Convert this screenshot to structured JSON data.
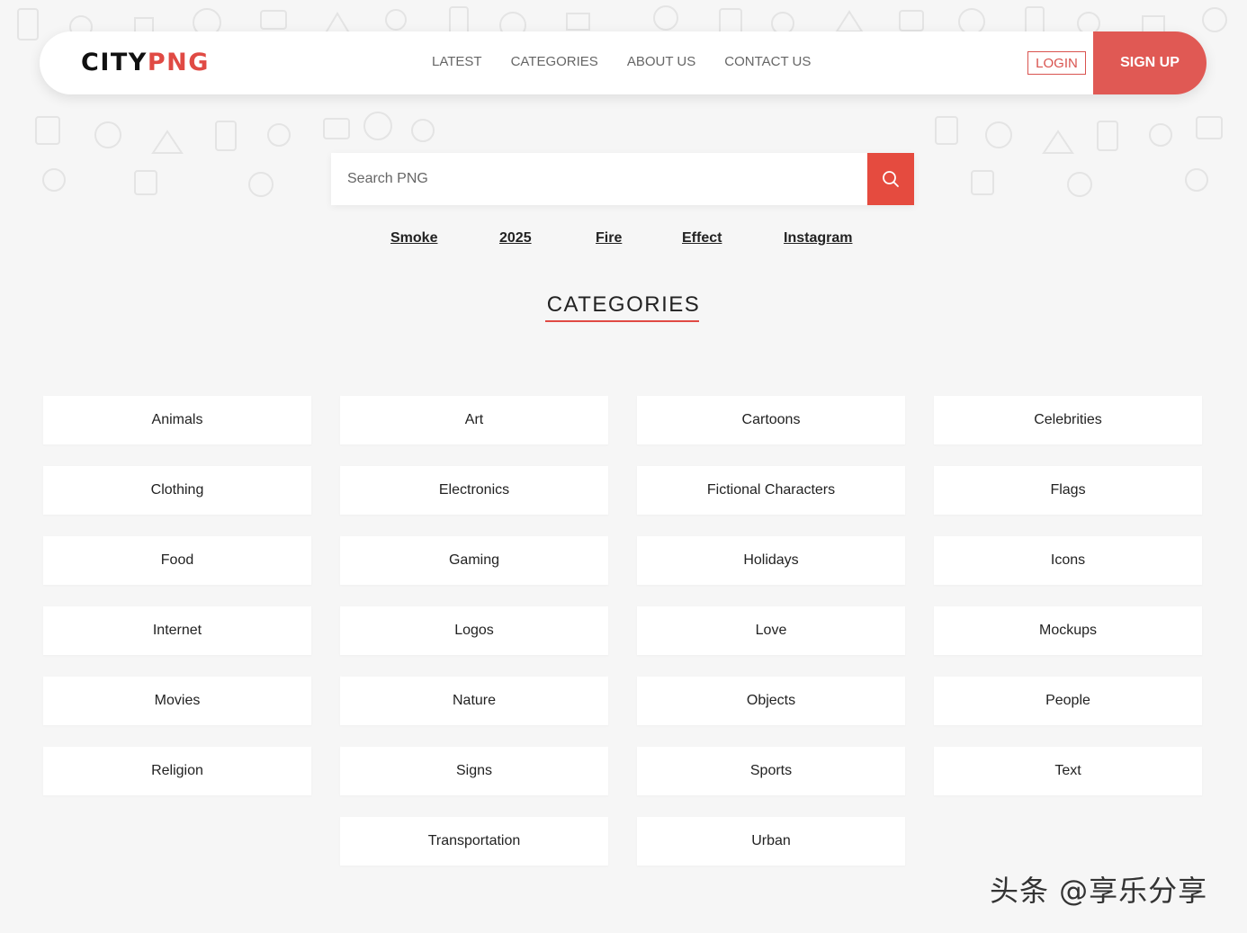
{
  "header": {
    "logo_city": "CITY",
    "logo_png": "PNG",
    "nav": [
      "LATEST",
      "CATEGORIES",
      "ABOUT US",
      "CONTACT US"
    ],
    "login_label": "LOGIN",
    "signup_label": "SIGN UP"
  },
  "search": {
    "placeholder": "Search PNG"
  },
  "tags": [
    "Smoke",
    "2025",
    "Fire",
    "Effect",
    "Instagram"
  ],
  "categories_title": "CATEGORIES",
  "categories": [
    "Animals",
    "Art",
    "Cartoons",
    "Celebrities",
    "Clothing",
    "Electronics",
    "Fictional Characters",
    "Flags",
    "Food",
    "Gaming",
    "Holidays",
    "Icons",
    "Internet",
    "Logos",
    "Love",
    "Mockups",
    "Movies",
    "Nature",
    "Objects",
    "People",
    "Religion",
    "Signs",
    "Sports",
    "Text",
    "Transportation",
    "Urban"
  ],
  "watermark": "头条 @享乐分享",
  "colors": {
    "accent": "#e04a44",
    "signup_bg": "#e05954",
    "search_button": "#e54b3f",
    "background": "#f6f6f6"
  }
}
